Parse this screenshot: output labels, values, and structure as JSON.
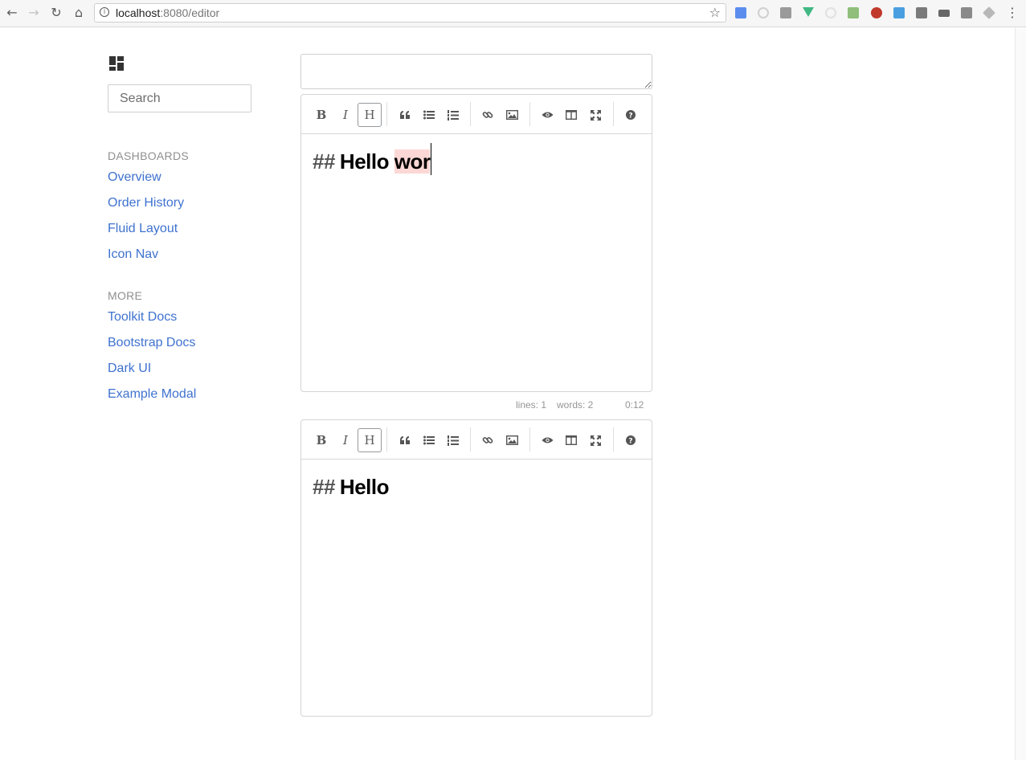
{
  "browser": {
    "url_host": "localhost",
    "url_rest": ":8080/editor",
    "back_icon": "back-arrow-icon",
    "forward_icon": "forward-arrow-icon",
    "reload_icon": "reload-icon",
    "home_icon": "home-icon",
    "bookmark_icon": "star-icon",
    "menu_icon": "kebab-menu-icon"
  },
  "sidebar": {
    "logo_icon": "dashboard-logo-icon",
    "search_placeholder": "Search",
    "sections": [
      {
        "header": "DASHBOARDS",
        "links": [
          "Overview",
          "Order History",
          "Fluid Layout",
          "Icon Nav"
        ]
      },
      {
        "header": "MORE",
        "links": [
          "Toolkit Docs",
          "Bootstrap Docs",
          "Dark UI",
          "Example Modal"
        ]
      }
    ],
    "link_color": "#3f72cf"
  },
  "toolbar": {
    "bold": "B",
    "italic": "I",
    "heading": "H",
    "icons": [
      "bold-icon",
      "italic-icon",
      "heading-icon",
      "quote-icon",
      "unordered-list-icon",
      "ordered-list-icon",
      "link-icon",
      "image-icon",
      "preview-icon",
      "side-by-side-icon",
      "fullscreen-icon",
      "help-icon"
    ]
  },
  "editor1": {
    "hashes": "##",
    "text_plain": "Hello",
    "text_marked": "wor",
    "status": {
      "lines_label": "lines: 1",
      "words_label": "words: 2",
      "time": "0:12"
    },
    "highlight_color": "#fbd8d5"
  },
  "editor2": {
    "hashes": "##",
    "text_plain": "Hello"
  }
}
